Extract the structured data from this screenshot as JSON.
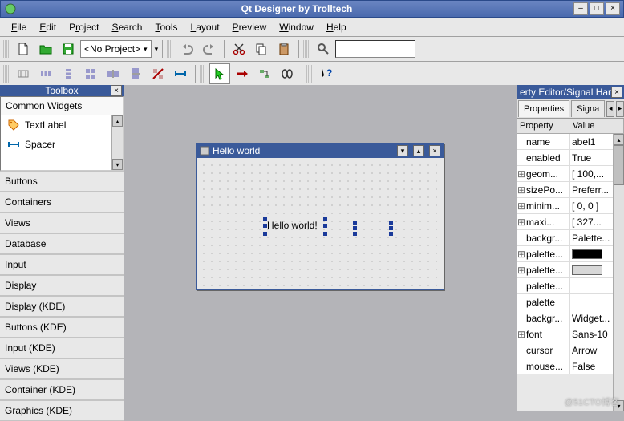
{
  "window": {
    "title": "Qt Designer by Trolltech"
  },
  "menu": {
    "file": "File",
    "edit": "Edit",
    "project": "Project",
    "search": "Search",
    "tools": "Tools",
    "layout": "Layout",
    "preview": "Preview",
    "window": "Window",
    "help": "Help"
  },
  "toolbar1": {
    "project_combo": "<No Project>"
  },
  "toolbox": {
    "title": "Toolbox",
    "open_category": "Common Widgets",
    "items": [
      {
        "label": "TextLabel"
      },
      {
        "label": "Spacer"
      }
    ],
    "categories": [
      "Buttons",
      "Containers",
      "Views",
      "Database",
      "Input",
      "Display",
      "Display (KDE)",
      "Buttons (KDE)",
      "Input (KDE)",
      "Views (KDE)",
      "Container (KDE)",
      "Graphics (KDE)"
    ]
  },
  "property_editor": {
    "title": "erty Editor/Signal Hand",
    "tabs": {
      "properties": "Properties",
      "signals": "Signa"
    },
    "headers": {
      "property": "Property",
      "value": "Value"
    },
    "rows": [
      {
        "exp": "",
        "name": "name",
        "val": "abel1"
      },
      {
        "exp": "",
        "name": "enabled",
        "val": "True"
      },
      {
        "exp": "⊞",
        "name": "geom...",
        "val": "[ 100,..."
      },
      {
        "exp": "⊞",
        "name": "sizePo...",
        "val": "Preferr..."
      },
      {
        "exp": "⊞",
        "name": "minim...",
        "val": "[ 0, 0 ]"
      },
      {
        "exp": "⊞",
        "name": "maxi...",
        "val": "[ 327..."
      },
      {
        "exp": "",
        "name": "backgr...",
        "val": "Palette..."
      },
      {
        "exp": "⊞",
        "name": "palette...",
        "val": "#000000",
        "swatch": true
      },
      {
        "exp": "⊞",
        "name": "palette...",
        "val": "#d8d8d8",
        "swatch": true
      },
      {
        "exp": "",
        "name": "palette...",
        "val": ""
      },
      {
        "exp": "",
        "name": "palette",
        "val": ""
      },
      {
        "exp": "",
        "name": "backgr...",
        "val": "Widget..."
      },
      {
        "exp": "⊞",
        "name": "font",
        "val": "Sans-10"
      },
      {
        "exp": "",
        "name": "cursor",
        "val": "Arrow"
      },
      {
        "exp": "",
        "name": "mouse...",
        "val": "False"
      }
    ]
  },
  "form": {
    "title": "Hello world",
    "label_text": "Hello world!"
  },
  "watermark": "@51CTO博客"
}
